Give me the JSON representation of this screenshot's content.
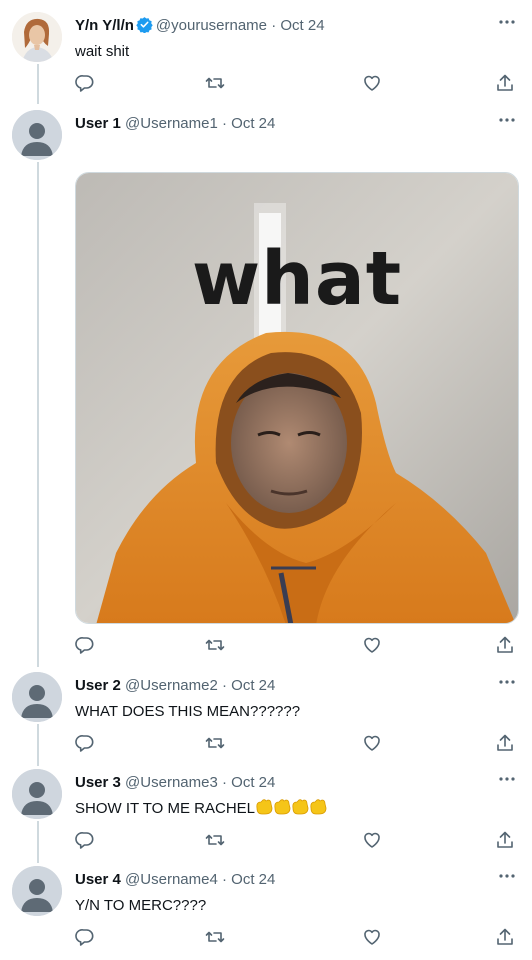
{
  "tweets": [
    {
      "name": "Y/n Y/l/n",
      "handle": "@yourusername",
      "date": "Oct 24",
      "text": "wait shit",
      "verified": true
    },
    {
      "name": "User 1",
      "handle": "@Username1",
      "date": "Oct 24",
      "text": "",
      "media_caption": "what"
    },
    {
      "name": "User 2",
      "handle": "@Username2",
      "date": "Oct 24",
      "text": "WHAT DOES THIS MEAN??????"
    },
    {
      "name": "User 3",
      "handle": "@Username3",
      "date": "Oct 24",
      "text": "SHOW IT TO ME RACHEL",
      "emoji_count": 4
    },
    {
      "name": "User 4",
      "handle": "@Username4",
      "date": "Oct 24",
      "text": "Y/N TO MERC????"
    }
  ],
  "separator": "·",
  "icons": {
    "reply": "reply-icon",
    "retweet": "retweet-icon",
    "like": "heart-icon",
    "share": "share-icon",
    "more": "more-icon",
    "verified": "verified-badge-icon"
  },
  "colors": {
    "text": "#0f1419",
    "secondary": "#536471",
    "verified": "#1d9bf0",
    "line": "#cfd9de",
    "hoodie": "#e8922a"
  }
}
